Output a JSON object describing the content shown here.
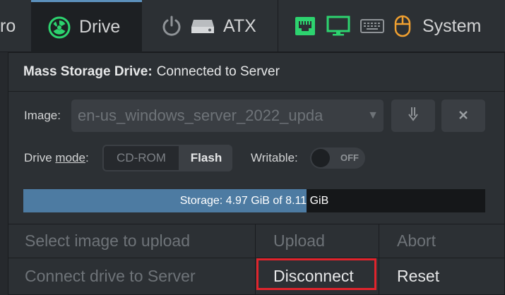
{
  "navbar": {
    "prev_label": "ro",
    "drive_label": "Drive",
    "atx_label": "ATX",
    "system_label": "System",
    "icons": [
      "drive-icon",
      "power-icon",
      "hdd-icon",
      "network-icon",
      "monitor-icon",
      "keyboard-icon",
      "mouse-icon"
    ],
    "colors": {
      "accent_green": "#2dd36f",
      "mouse_orange": "#f0a030",
      "active_top": "#5b90bb"
    }
  },
  "panel": {
    "title_bold": "Mass Storage Drive:",
    "title_status": "Connected to Server",
    "image_label": "Image:",
    "image_value": "en-us_windows_server_2022_upda",
    "download_icon": "download-icon",
    "remove_icon": "close-icon",
    "drive_mode_label_pre": "Drive ",
    "drive_mode_label_link": "mode",
    "drive_mode_label_post": ":",
    "mode_options": [
      "CD-ROM",
      "Flash"
    ],
    "mode_selected": "Flash",
    "writable_label": "Writable:",
    "writable_state": "OFF",
    "storage_text": "Storage: 4.97 GiB of 8.11 GiB",
    "storage_used_fraction": 0.6128
  },
  "actions": {
    "select_image": "Select image to upload",
    "upload": "Upload",
    "abort": "Abort",
    "connect": "Connect drive to Server",
    "disconnect": "Disconnect",
    "reset": "Reset"
  }
}
